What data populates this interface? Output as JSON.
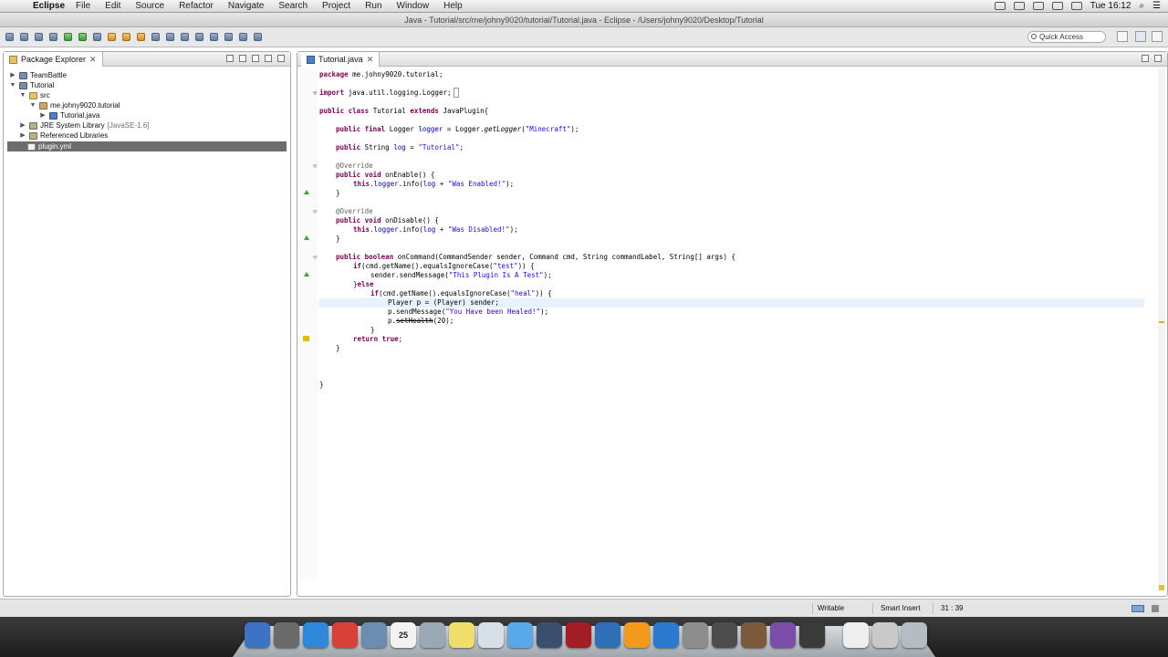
{
  "menubar": {
    "app": "Eclipse",
    "items": [
      "File",
      "Edit",
      "Source",
      "Refactor",
      "Navigate",
      "Search",
      "Project",
      "Run",
      "Window",
      "Help"
    ],
    "clock": "Tue 16:12"
  },
  "window": {
    "title": "Java - Tutorial/src/me/johny9020/tutorial/Tutorial.java - Eclipse - /Users/johny9020/Desktop/Tutorial"
  },
  "toolbar": {
    "quick_access_placeholder": "Quick Access"
  },
  "package_explorer": {
    "tab_label": "Package Explorer",
    "tree": [
      {
        "label": "TeamBattle",
        "icon": "project-icon"
      },
      {
        "label": "Tutorial",
        "icon": "project-icon"
      },
      {
        "label": "src",
        "icon": "source-folder-icon"
      },
      {
        "label": "me.johny9020.tutorial",
        "icon": "package-icon"
      },
      {
        "label": "Tutorial.java",
        "icon": "java-file-icon"
      },
      {
        "label": "JRE System Library",
        "suffix": "[JavaSE-1.6]",
        "icon": "library-icon"
      },
      {
        "label": "Referenced Libraries",
        "icon": "library-icon"
      },
      {
        "label": "plugin.yml",
        "icon": "yml-file-icon"
      }
    ]
  },
  "editor": {
    "tab_label": "Tutorial.java",
    "lines": {
      "l1": {
        "kw": "package",
        "rest": " me.johny9020.tutorial;"
      },
      "l2": {
        "kw": "import",
        "rest": " java.util.logging.Logger;"
      },
      "l3": {
        "kw1": "public",
        "sp1": " ",
        "kw2": "class",
        "mid": " Tutorial ",
        "kw3": "extends",
        "rest": " JavaPlugin{"
      },
      "l4": {
        "kw1": "public",
        "sp1": " ",
        "kw2": "final",
        "mid": " Logger ",
        "fld": "logger",
        "eq": " = Logger.",
        "meth": "getLogger",
        "op": "(",
        "str": "\"Minecraft\"",
        "end": ");"
      },
      "l5": {
        "kw": "public",
        "mid": " String ",
        "fld": "log",
        "eq": " = ",
        "str": "\"Tutorial\"",
        "end": ";"
      },
      "l6": {
        "ann": "@Override"
      },
      "l7": {
        "kw1": "public",
        "sp1": " ",
        "kw2": "void",
        "rest": " onEnable() {"
      },
      "l8": {
        "kw": "this",
        "dot": ".",
        "fld": "logger",
        "m1": ".info(",
        "fld2": "log",
        "plus": " + ",
        "str": "\"Was Enabled!\"",
        "end": ");"
      },
      "l9": {
        "text": "}"
      },
      "l10": {
        "ann": "@Override"
      },
      "l11": {
        "kw1": "public",
        "sp1": " ",
        "kw2": "void",
        "rest": " onDisable() {"
      },
      "l12": {
        "kw": "this",
        "dot": ".",
        "fld": "logger",
        "m1": ".info(",
        "fld2": "log",
        "plus": " + ",
        "str": "\"Was Disabled!\"",
        "end": ");"
      },
      "l13": {
        "text": "}"
      },
      "l14": {
        "kw1": "public",
        "sp1": " ",
        "kw2": "boolean",
        "rest": " onCommand(CommandSender sender, Command cmd, String commandLabel, String[] args) {"
      },
      "l15": {
        "kw": "if",
        "rest": "(cmd.getName().equalsIgnoreCase(",
        "str": "\"test\"",
        "end": ")) {"
      },
      "l16": {
        "rest": "sender.sendMessage(",
        "str": "\"This Plugin Is A Test\"",
        "end": ");"
      },
      "l17": {
        "pre": "}",
        "kw": "else"
      },
      "l18": {
        "kw": "if",
        "rest": "(cmd.getName().equalsIgnoreCase(",
        "str": "\"heal\"",
        "end": ")) {"
      },
      "l19": {
        "text": "Player p = (Player) sender;"
      },
      "l20": {
        "rest": "p.sendMessage(",
        "str": "\"You Have been Healed!\"",
        "end": ");"
      },
      "l21": {
        "pre": "p.",
        "strike": "setHealth",
        "end": "(20);"
      },
      "l22": {
        "text": "}"
      },
      "l23": {
        "kw": "return",
        "sp": " ",
        "kw2": "true",
        "end": ";"
      },
      "l24": {
        "text": "}"
      },
      "l25": {
        "text": "}"
      }
    }
  },
  "statusbar": {
    "writable": "Writable",
    "insert_mode": "Smart Insert",
    "position": "31 : 39"
  },
  "dock": {
    "calendar_day": "25"
  }
}
